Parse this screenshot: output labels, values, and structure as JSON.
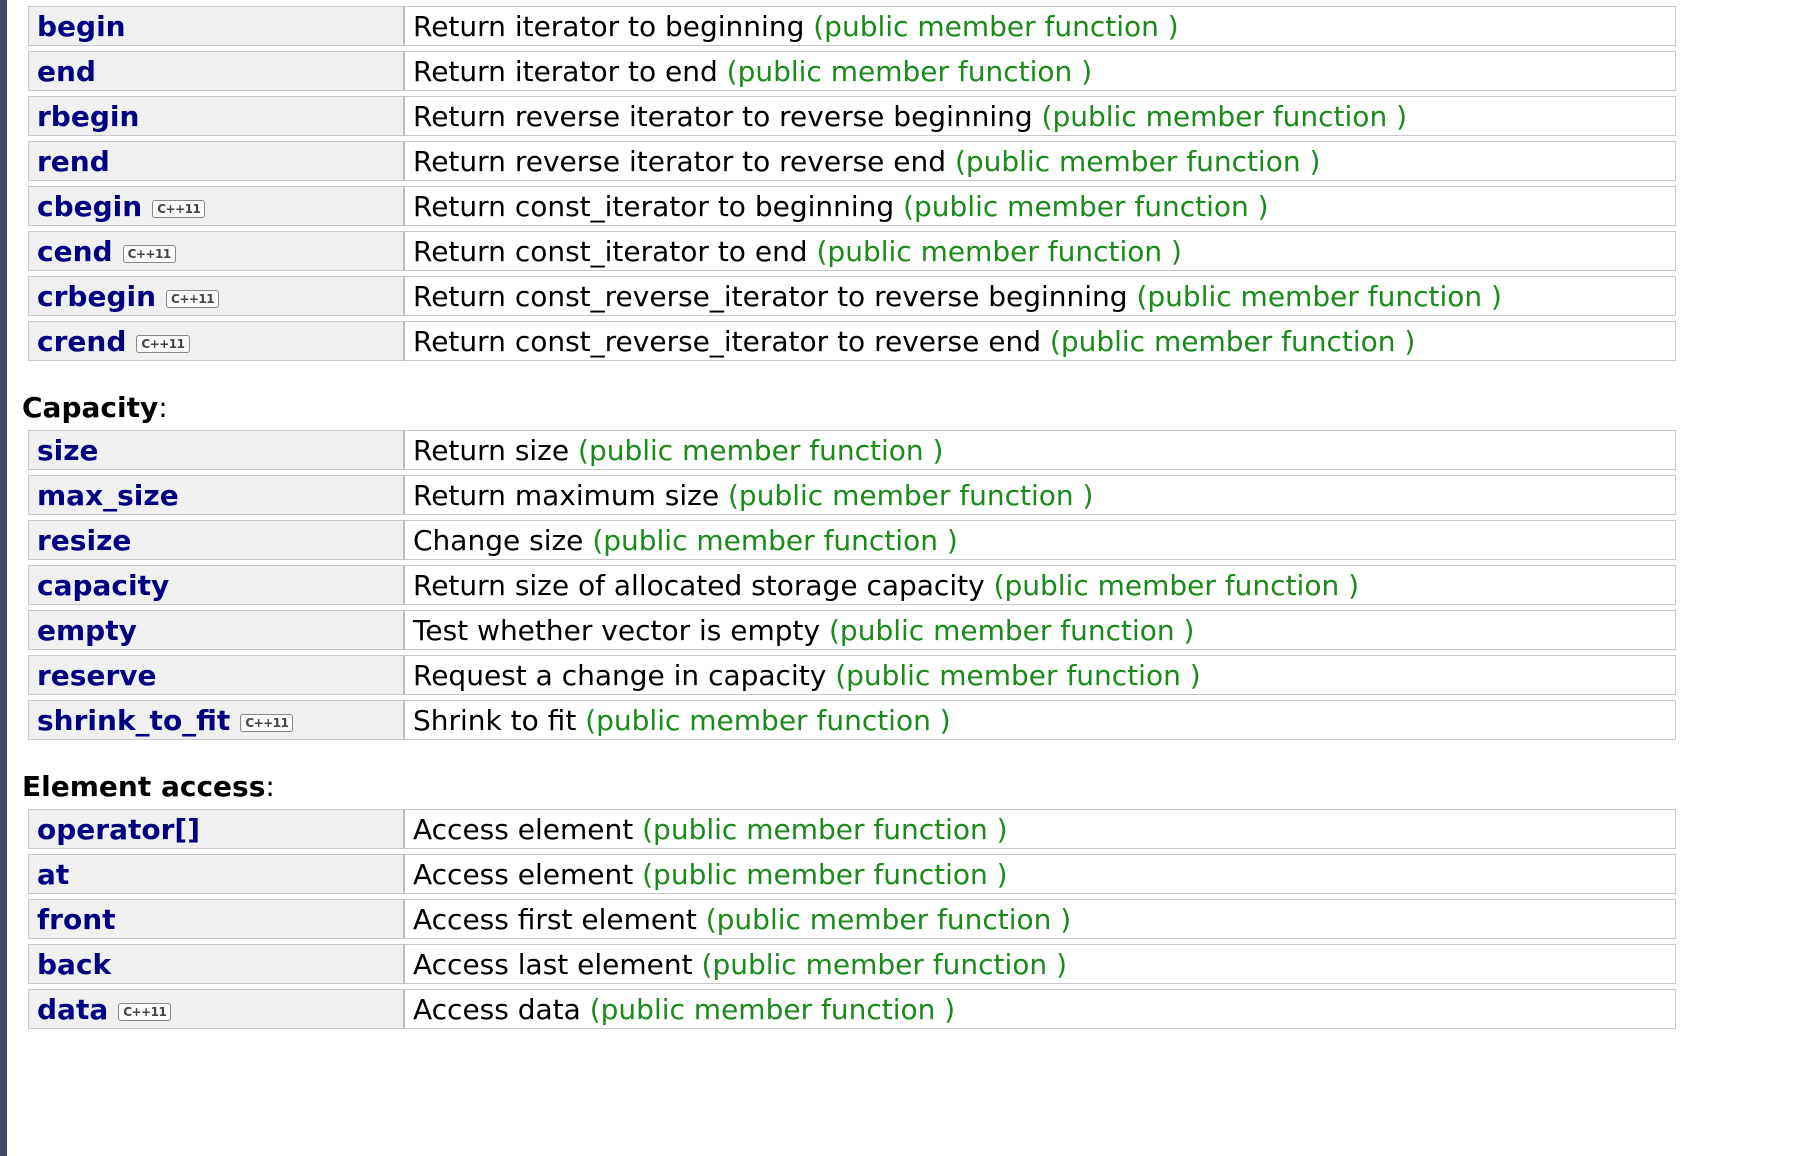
{
  "sections": [
    {
      "title": "",
      "rows": [
        {
          "name": "begin",
          "badge": "",
          "desc": "Return iterator to beginning",
          "kind": "(public member function )"
        },
        {
          "name": "end",
          "badge": "",
          "desc": "Return iterator to end",
          "kind": "(public member function )"
        },
        {
          "name": "rbegin",
          "badge": "",
          "desc": "Return reverse iterator to reverse beginning",
          "kind": "(public member function )"
        },
        {
          "name": "rend",
          "badge": "",
          "desc": "Return reverse iterator to reverse end",
          "kind": "(public member function )"
        },
        {
          "name": "cbegin",
          "badge": "C++11",
          "desc": "Return const_iterator to beginning",
          "kind": "(public member function )"
        },
        {
          "name": "cend",
          "badge": "C++11",
          "desc": "Return const_iterator to end",
          "kind": "(public member function )"
        },
        {
          "name": "crbegin",
          "badge": "C++11",
          "desc": "Return const_reverse_iterator to reverse beginning",
          "kind": "(public member function )"
        },
        {
          "name": "crend",
          "badge": "C++11",
          "desc": "Return const_reverse_iterator to reverse end",
          "kind": "(public member function )"
        }
      ]
    },
    {
      "title": "Capacity",
      "rows": [
        {
          "name": "size",
          "badge": "",
          "desc": "Return size",
          "kind": "(public member function )"
        },
        {
          "name": "max_size",
          "badge": "",
          "desc": "Return maximum size",
          "kind": "(public member function )"
        },
        {
          "name": "resize",
          "badge": "",
          "desc": "Change size",
          "kind": "(public member function )"
        },
        {
          "name": "capacity",
          "badge": "",
          "desc": "Return size of allocated storage capacity",
          "kind": "(public member function )"
        },
        {
          "name": "empty",
          "badge": "",
          "desc": "Test whether vector is empty",
          "kind": "(public member function )"
        },
        {
          "name": "reserve",
          "badge": "",
          "desc": "Request a change in capacity",
          "kind": "(public member function )"
        },
        {
          "name": "shrink_to_fit",
          "badge": "C++11",
          "desc": "Shrink to fit",
          "kind": "(public member function )"
        }
      ]
    },
    {
      "title": "Element access",
      "rows": [
        {
          "name": "operator[]",
          "badge": "",
          "desc": "Access element",
          "kind": "(public member function )"
        },
        {
          "name": "at",
          "badge": "",
          "desc": "Access element",
          "kind": "(public member function )"
        },
        {
          "name": "front",
          "badge": "",
          "desc": "Access first element",
          "kind": "(public member function )"
        },
        {
          "name": "back",
          "badge": "",
          "desc": "Access last element",
          "kind": "(public member function )"
        },
        {
          "name": "data",
          "badge": "C++11",
          "desc": "Access data",
          "kind": "(public member function )"
        }
      ]
    }
  ],
  "colors": {
    "member_name": "#000080",
    "member_kind": "#1a8a1a",
    "name_cell_bg": "#f0f0f0",
    "left_rule": "#43486a"
  }
}
